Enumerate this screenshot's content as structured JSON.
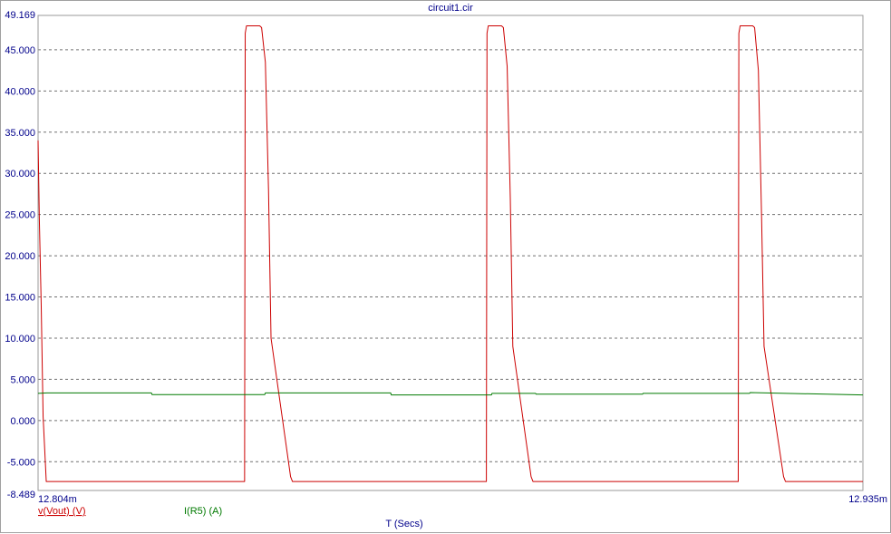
{
  "chart_data": {
    "type": "line",
    "title": "circuit1.cir",
    "xlabel": "T (Secs)",
    "ylabel": "",
    "xlim": [
      12.804,
      12.935
    ],
    "ylim": [
      -8.489,
      49.169
    ],
    "x_tick_labels": [
      "12.804m",
      "12.935m"
    ],
    "y_ticks": [
      45,
      40,
      35,
      30,
      25,
      20,
      15,
      10,
      5,
      0,
      -5
    ],
    "y_tick_labels": [
      "49.169",
      "45.000",
      "40.000",
      "35.000",
      "30.000",
      "25.000",
      "20.000",
      "15.000",
      "10.000",
      "5.000",
      "0.000",
      "-5.000",
      "-8.489"
    ],
    "grid": true,
    "series": [
      {
        "name": "v(Vout) (V)",
        "color": "#cc0000",
        "x": [
          12.804,
          12.8042,
          12.8045,
          12.8048,
          12.8053,
          12.8368,
          12.8369,
          12.8371,
          12.8392,
          12.8395,
          12.8401,
          12.8406,
          12.841,
          12.8441,
          12.8444,
          12.8752,
          12.8753,
          12.8755,
          12.8776,
          12.8779,
          12.8785,
          12.879,
          12.8794,
          12.8823,
          12.8826,
          12.9152,
          12.9153,
          12.9155,
          12.9175,
          12.9178,
          12.9184,
          12.9189,
          12.9193,
          12.9224,
          12.9227,
          12.935
        ],
        "y": [
          34.0,
          24.5,
          14.0,
          0.5,
          -7.4,
          -7.4,
          47.0,
          47.9,
          47.9,
          47.7,
          43.5,
          28.0,
          10.0,
          -6.8,
          -7.4,
          -7.4,
          47.0,
          47.9,
          47.9,
          47.7,
          43.0,
          27.0,
          9.0,
          -6.8,
          -7.4,
          -7.4,
          47.0,
          47.9,
          47.9,
          47.7,
          42.5,
          25.0,
          9.0,
          -6.8,
          -7.4,
          -7.4
        ]
      },
      {
        "name": "I(R5) (A)",
        "color": "#007a00",
        "x": [
          12.804,
          12.8054,
          12.822,
          12.8221,
          12.84,
          12.8401,
          12.86,
          12.8601,
          12.876,
          12.8761,
          12.883,
          12.8831,
          12.9,
          12.9001,
          12.917,
          12.9171,
          12.935
        ],
        "y": [
          3.3,
          3.35,
          3.35,
          3.15,
          3.15,
          3.35,
          3.35,
          3.1,
          3.1,
          3.3,
          3.3,
          3.2,
          3.2,
          3.3,
          3.3,
          3.4,
          3.1
        ]
      }
    ]
  }
}
